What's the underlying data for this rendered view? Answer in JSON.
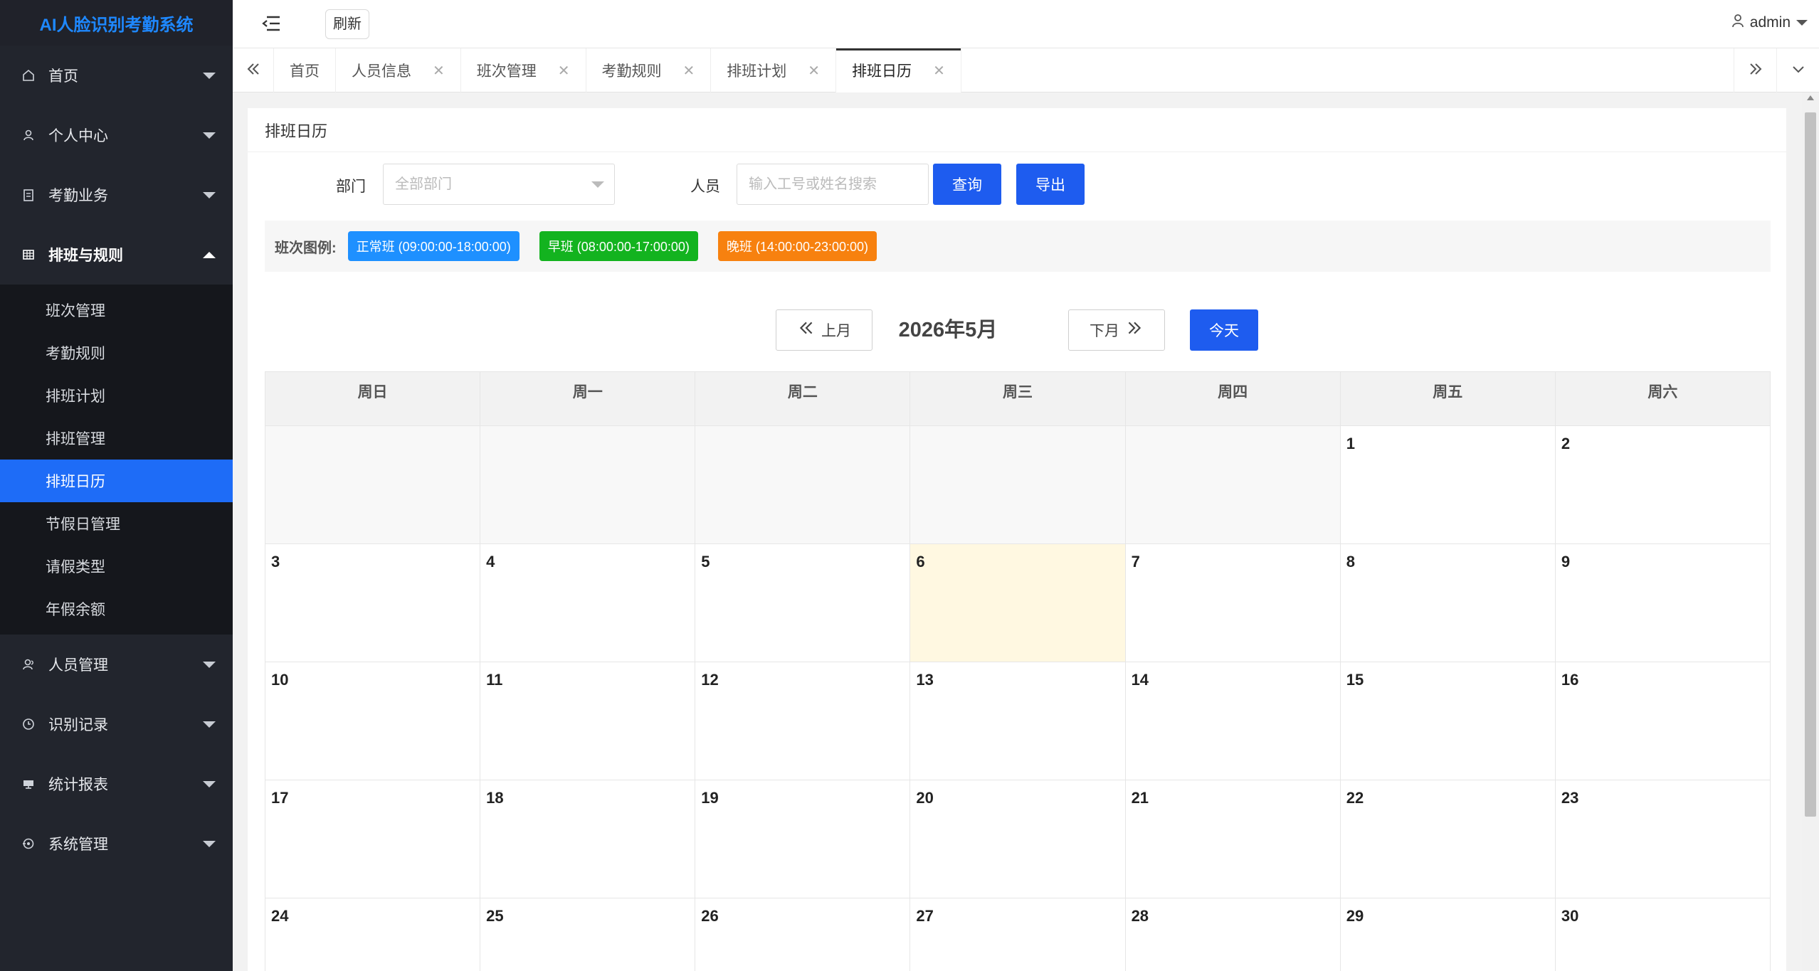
{
  "app": {
    "title": "AI人脸识别考勤系统"
  },
  "sidebar": {
    "items": [
      {
        "label": "首页",
        "icon": "home-icon"
      },
      {
        "label": "个人中心",
        "icon": "user-icon"
      },
      {
        "label": "考勤业务",
        "icon": "clipboard-icon"
      },
      {
        "label": "排班与规则",
        "icon": "grid-icon",
        "expanded": true
      },
      {
        "label": "人员管理",
        "icon": "person-icon"
      },
      {
        "label": "识别记录",
        "icon": "clock-icon"
      },
      {
        "label": "统计报表",
        "icon": "monitor-icon"
      },
      {
        "label": "系统管理",
        "icon": "settings-icon"
      }
    ],
    "submenu": [
      {
        "label": "班次管理"
      },
      {
        "label": "考勤规则"
      },
      {
        "label": "排班计划"
      },
      {
        "label": "排班管理"
      },
      {
        "label": "排班日历",
        "active": true
      },
      {
        "label": "节假日管理"
      },
      {
        "label": "请假类型"
      },
      {
        "label": "年假余额"
      }
    ]
  },
  "header": {
    "refresh_label": "刷新",
    "username": "admin"
  },
  "tabs": [
    {
      "label": "首页",
      "closable": false
    },
    {
      "label": "人员信息",
      "closable": true
    },
    {
      "label": "班次管理",
      "closable": true
    },
    {
      "label": "考勤规则",
      "closable": true
    },
    {
      "label": "排班计划",
      "closable": true
    },
    {
      "label": "排班日历",
      "closable": true,
      "active": true
    }
  ],
  "page": {
    "title": "排班日历",
    "filter": {
      "dept_label": "部门",
      "dept_placeholder": "全部部门",
      "person_label": "人员",
      "person_placeholder": "输入工号或姓名搜索",
      "query_label": "查询",
      "export_label": "导出"
    },
    "legend": {
      "title": "班次图例:",
      "shifts": [
        {
          "label": "正常班 (09:00:00-18:00:00)",
          "color": "#1e90ff"
        },
        {
          "label": "早班 (08:00:00-17:00:00)",
          "color": "#13b31f"
        },
        {
          "label": "晚班 (14:00:00-23:00:00)",
          "color": "#f7810f"
        }
      ]
    },
    "calendar": {
      "prev_label": "上月",
      "next_label": "下月",
      "month_label": "2026年5月",
      "today_label": "今天",
      "weekdays": [
        "周日",
        "周一",
        "周二",
        "周三",
        "周四",
        "周五",
        "周六"
      ],
      "weeks": [
        [
          "",
          "",
          "",
          "",
          "",
          "1",
          "2"
        ],
        [
          "3",
          "4",
          "5",
          "6",
          "7",
          "8",
          "9"
        ],
        [
          "10",
          "11",
          "12",
          "13",
          "14",
          "15",
          "16"
        ],
        [
          "17",
          "18",
          "19",
          "20",
          "21",
          "22",
          "23"
        ],
        [
          "24",
          "25",
          "26",
          "27",
          "28",
          "29",
          "30"
        ]
      ],
      "today": "6"
    }
  },
  "colors": {
    "accent": "#1e5cef",
    "sidebar_bg": "#22252d",
    "today_bg": "#fff8e1"
  }
}
